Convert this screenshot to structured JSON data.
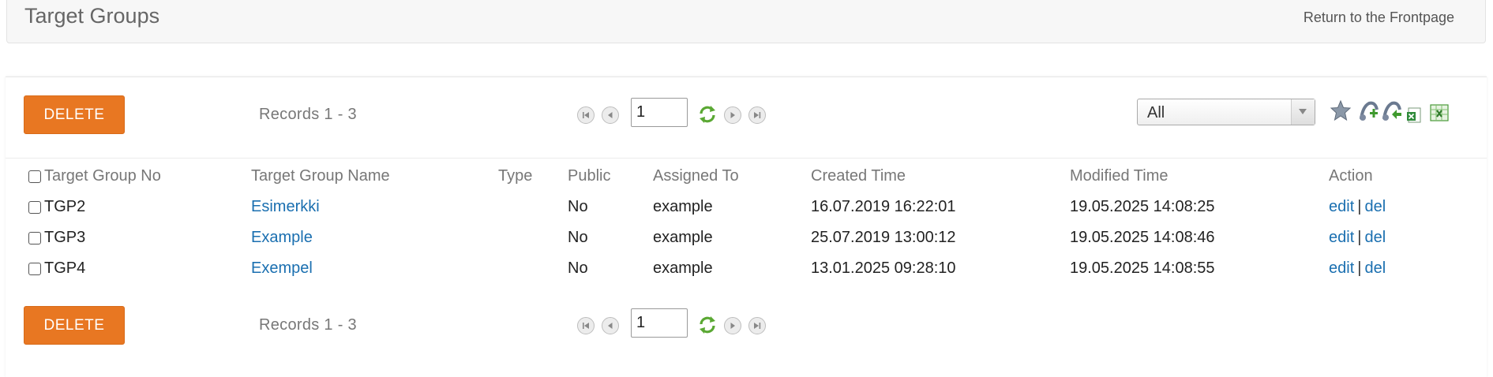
{
  "header": {
    "title": "Target Groups",
    "return_link": "Return to the Frontpage"
  },
  "toolbar": {
    "delete_label": "DELETE",
    "records_text": "Records 1 - 3",
    "page_value": "1",
    "filter_value": "All"
  },
  "table": {
    "columns": [
      "Target Group No",
      "Target Group Name",
      "Type",
      "Public",
      "Assigned To",
      "Created Time",
      "Modified Time",
      "Action"
    ],
    "rows": [
      {
        "no": "TGP2",
        "name": "Esimerkki",
        "type": "",
        "public": "No",
        "assigned": "example",
        "created": "16.07.2019 16:22:01",
        "modified": "19.05.2025 14:08:25",
        "edit": "edit",
        "sep": "|",
        "del": "del"
      },
      {
        "no": "TGP3",
        "name": "Example",
        "type": "",
        "public": "No",
        "assigned": "example",
        "created": "25.07.2019 13:00:12",
        "modified": "19.05.2025 14:08:46",
        "edit": "edit",
        "sep": "|",
        "del": "del"
      },
      {
        "no": "TGP4",
        "name": "Exempel",
        "type": "",
        "public": "No",
        "assigned": "example",
        "created": "13.01.2025 09:28:10",
        "modified": "19.05.2025 14:08:55",
        "edit": "edit",
        "sep": "|",
        "del": "del"
      }
    ]
  },
  "icons": [
    "first-page-icon",
    "prev-page-icon",
    "refresh-icon",
    "next-page-icon",
    "last-page-icon",
    "star-icon",
    "import-icon",
    "export-icon",
    "excel-icon",
    "excel-export-icon",
    "chevron-down-icon"
  ],
  "colors": {
    "accent": "#e87722",
    "link": "#1a6fb0",
    "refresh": "#5aa833"
  }
}
